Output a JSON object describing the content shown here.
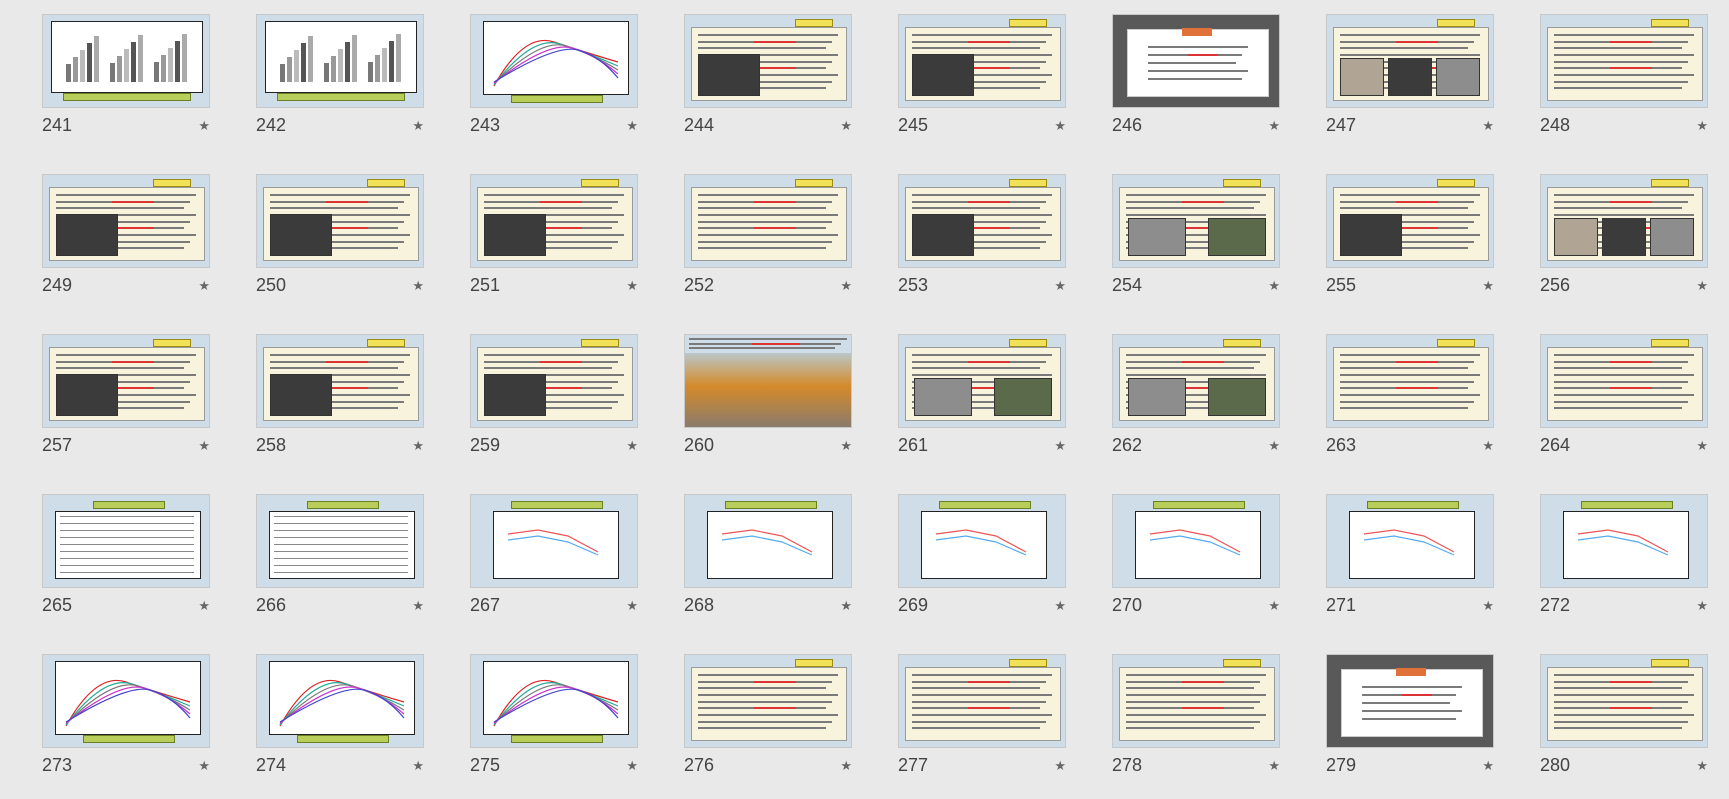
{
  "colors": {
    "background": "#e9e9e9",
    "slide_bg": "#cfdde8",
    "accent_green": "#b7cf5a",
    "accent_yellow": "#f2e25a",
    "cover_bg": "#595959"
  },
  "star_glyph": "★",
  "slides": [
    {
      "number": "241",
      "type": "bar-chart"
    },
    {
      "number": "242",
      "type": "bar-chart"
    },
    {
      "number": "243",
      "type": "curve-chart"
    },
    {
      "number": "244",
      "type": "text-photo"
    },
    {
      "number": "245",
      "type": "text-photo"
    },
    {
      "number": "246",
      "type": "cover"
    },
    {
      "number": "247",
      "type": "three-photos"
    },
    {
      "number": "248",
      "type": "text"
    },
    {
      "number": "249",
      "type": "text-photo"
    },
    {
      "number": "250",
      "type": "text-photo"
    },
    {
      "number": "251",
      "type": "text-photo"
    },
    {
      "number": "252",
      "type": "text"
    },
    {
      "number": "253",
      "type": "photo-text"
    },
    {
      "number": "254",
      "type": "two-photos"
    },
    {
      "number": "255",
      "type": "photo-text"
    },
    {
      "number": "256",
      "type": "three-photos"
    },
    {
      "number": "257",
      "type": "photo-text"
    },
    {
      "number": "258",
      "type": "photo-text"
    },
    {
      "number": "259",
      "type": "photo-text"
    },
    {
      "number": "260",
      "type": "full-photo"
    },
    {
      "number": "261",
      "type": "two-photos"
    },
    {
      "number": "262",
      "type": "two-photos"
    },
    {
      "number": "263",
      "type": "text"
    },
    {
      "number": "264",
      "type": "text"
    },
    {
      "number": "265",
      "type": "table"
    },
    {
      "number": "266",
      "type": "table"
    },
    {
      "number": "267",
      "type": "line-chart"
    },
    {
      "number": "268",
      "type": "line-chart"
    },
    {
      "number": "269",
      "type": "line-chart"
    },
    {
      "number": "270",
      "type": "line-chart"
    },
    {
      "number": "271",
      "type": "line-chart"
    },
    {
      "number": "272",
      "type": "line-chart"
    },
    {
      "number": "273",
      "type": "curve-chart"
    },
    {
      "number": "274",
      "type": "curve-chart"
    },
    {
      "number": "275",
      "type": "curve-chart"
    },
    {
      "number": "276",
      "type": "text"
    },
    {
      "number": "277",
      "type": "text"
    },
    {
      "number": "278",
      "type": "text"
    },
    {
      "number": "279",
      "type": "cover"
    },
    {
      "number": "280",
      "type": "text"
    }
  ]
}
